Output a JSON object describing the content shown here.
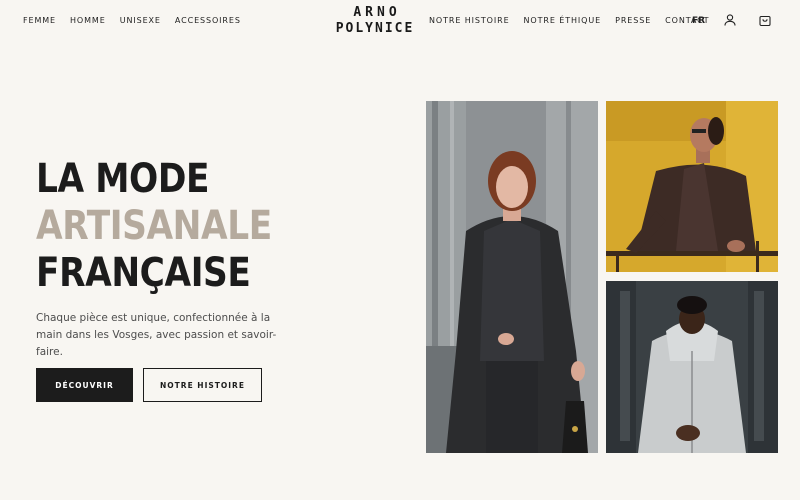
{
  "nav": {
    "left": [
      "FEMME",
      "HOMME",
      "UNISEXE",
      "ACCESSOIRES"
    ],
    "right": [
      "NOTRE HISTOIRE",
      "NOTRE ÉTHIQUE",
      "PRESSE",
      "CONTACT"
    ],
    "lang": "FR",
    "icons": [
      "user-icon",
      "cart-icon"
    ]
  },
  "brand": {
    "line1": "ARNO",
    "line2": "POLYNICE"
  },
  "hero": {
    "title_line1": "LA MODE",
    "title_line2": "ARTISANALE",
    "title_line3": "FRANÇAISE",
    "description": "Chaque pièce est unique, confectionnée à la main dans les Vosges, avec passion et savoir-faire.",
    "primary_button": "DÉCOUVRIR",
    "secondary_button": "NOTRE HISTOIRE"
  },
  "colors": {
    "background": "#f8f6f2",
    "text_dark": "#1c1c1c",
    "accent_beige": "#b5aa9d"
  }
}
